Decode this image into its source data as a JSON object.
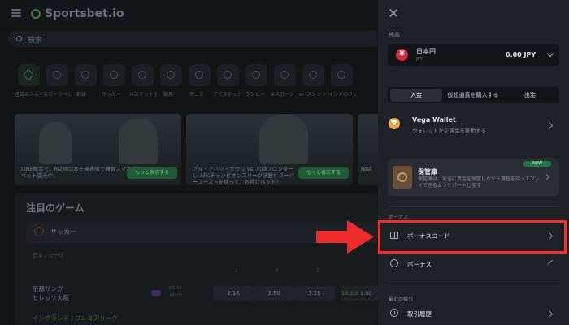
{
  "background": {
    "logo_text": "Sportsbet.io",
    "search_placeholder": "検索",
    "categories": [
      "注目のスポーツ",
      "スポーツベット",
      "野球",
      "サッカー",
      "バスケットボール",
      "競馬",
      "テニス",
      "アイスホッケー",
      "ラグビー",
      "eスポーツ",
      "eバスケットボール",
      "インドのクリケット"
    ],
    "banners": [
      {
        "text": "LINE限定で、RIZINは本土発表後で複数スマホプリーベット還元中！",
        "button": "もっと表示する"
      },
      {
        "text": "アル・アハリ・サウジ vs. 川崎フロンターレ AFCチャンピオンズリーグ決勝！スーパーブーストを使って、お得にベット！",
        "button": "もっと表示する"
      },
      {
        "text": "NBA",
        "button": ""
      }
    ],
    "games_title": "注目のゲーム",
    "sport_label": "サッカー",
    "league_label": "日本 / リーグ",
    "col_labels": [
      "1",
      "X",
      "2"
    ],
    "match": {
      "home": "京都サンガ",
      "away": "セレッソ大阪",
      "date": "01.03",
      "time": "13:00",
      "odds": [
        "2.16",
        "3.50",
        "3.25"
      ],
      "side_label": "1X 2.0",
      "side_value": "1.90"
    },
    "next_league": "イングランド / プレミアリーグ"
  },
  "drawer": {
    "wallet_section_label": "残高",
    "currency_name": "日本円",
    "currency_code": "JPY",
    "balance": "0.00 JPY",
    "tabs": [
      "入金",
      "仮想通貨を購入する",
      "出金"
    ],
    "vega": {
      "title": "Vega Wallet",
      "subtitle": "ウォレットから資金を移動する"
    },
    "vault": {
      "title": "保管庫",
      "subtitle": "保管庫は、安全に資金を保管しながら責任を持ってプレイできるようサポートします",
      "badge": "NEW"
    },
    "bonus_section_label": "ボーナス",
    "bonus_code": "ボーナスコード",
    "bonus": "ボーナス",
    "history_section_label": "最近の取引",
    "history": "取引履歴"
  }
}
